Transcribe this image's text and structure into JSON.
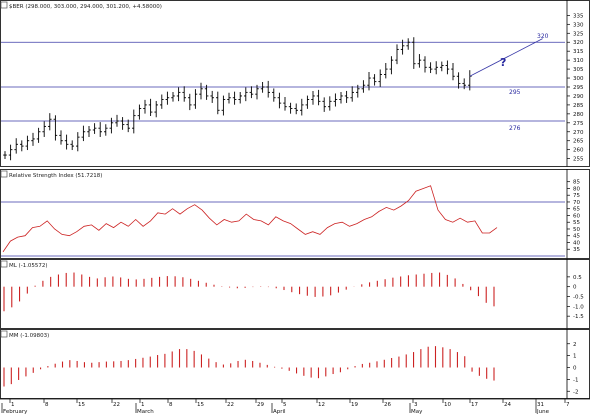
{
  "panels": {
    "price": {
      "header": "$BER (298.000, 303.000, 294.000, 301.200, +4.58000)",
      "hlines": [
        320,
        295,
        276
      ],
      "hline_labels": [
        "320",
        "295",
        "276"
      ],
      "question_mark": "?"
    },
    "rsi": {
      "header": "Relative Strength Index (51.7218)",
      "hlines": [
        70,
        30
      ]
    },
    "ml": {
      "header": "ML (-1.05572)"
    },
    "mm": {
      "header": "MM (-1.09803)"
    }
  },
  "x_axis": {
    "day_labels": [
      "1",
      "8",
      "15",
      "22",
      "1",
      "8",
      "15",
      "22",
      "29",
      "5",
      "12",
      "19",
      "26",
      "3",
      "10",
      "17",
      "24",
      "31",
      "7"
    ],
    "month_labels": [
      "February",
      "March",
      "April",
      "May",
      "June"
    ]
  },
  "chart_data": [
    {
      "type": "ohlc",
      "title": "$BER (298.000, 303.000, 294.000, 301.200, +4.58000)",
      "ylim": [
        252,
        338
      ],
      "yticks": [
        255,
        260,
        265,
        270,
        275,
        280,
        285,
        290,
        295,
        300,
        305,
        310,
        315,
        320,
        325,
        330,
        335
      ],
      "grid": false,
      "close": [
        257,
        260,
        263,
        262,
        265,
        266,
        270,
        273,
        277,
        268,
        265,
        263,
        262,
        267,
        270,
        271,
        272,
        270,
        272,
        275,
        276,
        274,
        272,
        279,
        283,
        285,
        281,
        285,
        288,
        289,
        290,
        292,
        289,
        285,
        291,
        294,
        290,
        289,
        282,
        288,
        289,
        288,
        290,
        292,
        291,
        294,
        295,
        292,
        289,
        286,
        284,
        283,
        282,
        285,
        288,
        290,
        287,
        284,
        287,
        288,
        290,
        289,
        292,
        294,
        296,
        300,
        298,
        302,
        305,
        310,
        316,
        318,
        320,
        308,
        310,
        306,
        305,
        306,
        307,
        305,
        301,
        297,
        296,
        301
      ],
      "annotations": [
        "320",
        "295",
        "276",
        "?"
      ],
      "trend_line": [
        [
          83,
          301
        ],
        [
          96,
          322
        ]
      ]
    },
    {
      "type": "line",
      "title": "Relative Strength Index (51.7218)",
      "ylim": [
        30,
        87
      ],
      "yticks": [
        35,
        40,
        45,
        50,
        55,
        60,
        65,
        70,
        75,
        80,
        85
      ],
      "hlines": [
        70,
        30
      ],
      "values": [
        33,
        41,
        44,
        45,
        51,
        52,
        56,
        50,
        46,
        45,
        48,
        52,
        53,
        49,
        54,
        51,
        55,
        52,
        57,
        52,
        56,
        62,
        61,
        65,
        61,
        65,
        68,
        64,
        58,
        53,
        57,
        55,
        56,
        61,
        57,
        56,
        53,
        59,
        56,
        54,
        50,
        46,
        48,
        46,
        51,
        54,
        55,
        52,
        54,
        57,
        59,
        63,
        66,
        64,
        67,
        71,
        78,
        80,
        82,
        64,
        57,
        55,
        58,
        55,
        56,
        47,
        47,
        51
      ]
    },
    {
      "type": "histogram",
      "title": "ML (-1.05572)",
      "ylim": [
        -2,
        0.9
      ],
      "yticks": [
        -1.5,
        -1.0,
        -0.5,
        0,
        0.5
      ],
      "values": [
        -1.25,
        -1.05,
        -0.75,
        -0.35,
        0.05,
        0.3,
        0.5,
        0.62,
        0.7,
        0.72,
        0.62,
        0.5,
        0.42,
        0.48,
        0.52,
        0.47,
        0.4,
        0.37,
        0.4,
        0.45,
        0.5,
        0.54,
        0.53,
        0.48,
        0.4,
        0.3,
        0.2,
        0.1,
        0.02,
        -0.04,
        -0.08,
        -0.06,
        -0.02,
        0.02,
        -0.02,
        -0.08,
        -0.17,
        -0.28,
        -0.38,
        -0.46,
        -0.52,
        -0.5,
        -0.44,
        -0.3,
        -0.15,
        -0.01,
        0.12,
        0.22,
        0.3,
        0.38,
        0.46,
        0.52,
        0.58,
        0.62,
        0.66,
        0.7,
        0.72,
        0.6,
        0.42,
        0.14,
        -0.18,
        -0.48,
        -0.82,
        -1.0
      ],
      "negative_cutoff": 0.35
    },
    {
      "type": "histogram",
      "title": "MM (-1.09803)",
      "ylim": [
        -2.4,
        2.4
      ],
      "yticks": [
        -2,
        -1,
        0,
        1,
        2
      ],
      "values": [
        -1.6,
        -1.4,
        -1.05,
        -0.75,
        -0.45,
        -0.15,
        0.12,
        0.32,
        0.5,
        0.62,
        0.55,
        0.45,
        0.4,
        0.45,
        0.5,
        0.52,
        0.55,
        0.62,
        0.72,
        0.82,
        0.92,
        1.05,
        1.15,
        1.35,
        1.55,
        1.55,
        1.4,
        1.1,
        0.75,
        0.45,
        0.25,
        0.35,
        0.55,
        0.65,
        0.55,
        0.4,
        0.22,
        0.06,
        -0.1,
        -0.28,
        -0.5,
        -0.7,
        -0.85,
        -0.9,
        -0.75,
        -0.55,
        -0.4,
        -0.15,
        0.12,
        0.3,
        0.4,
        0.52,
        0.65,
        0.8,
        0.92,
        1.1,
        1.3,
        1.55,
        1.75,
        1.8,
        1.7,
        1.55,
        1.3,
        0.95,
        -0.35,
        -0.7,
        -0.95,
        -1.1
      ],
      "negative_cutoff": 0.48
    }
  ],
  "colors": {
    "bar": "#000000",
    "hline": "#3a3aa8",
    "label": "#2a2aa0",
    "rsi_line": "#cc2222",
    "hist": "#cc2222",
    "axis": "#000000"
  }
}
